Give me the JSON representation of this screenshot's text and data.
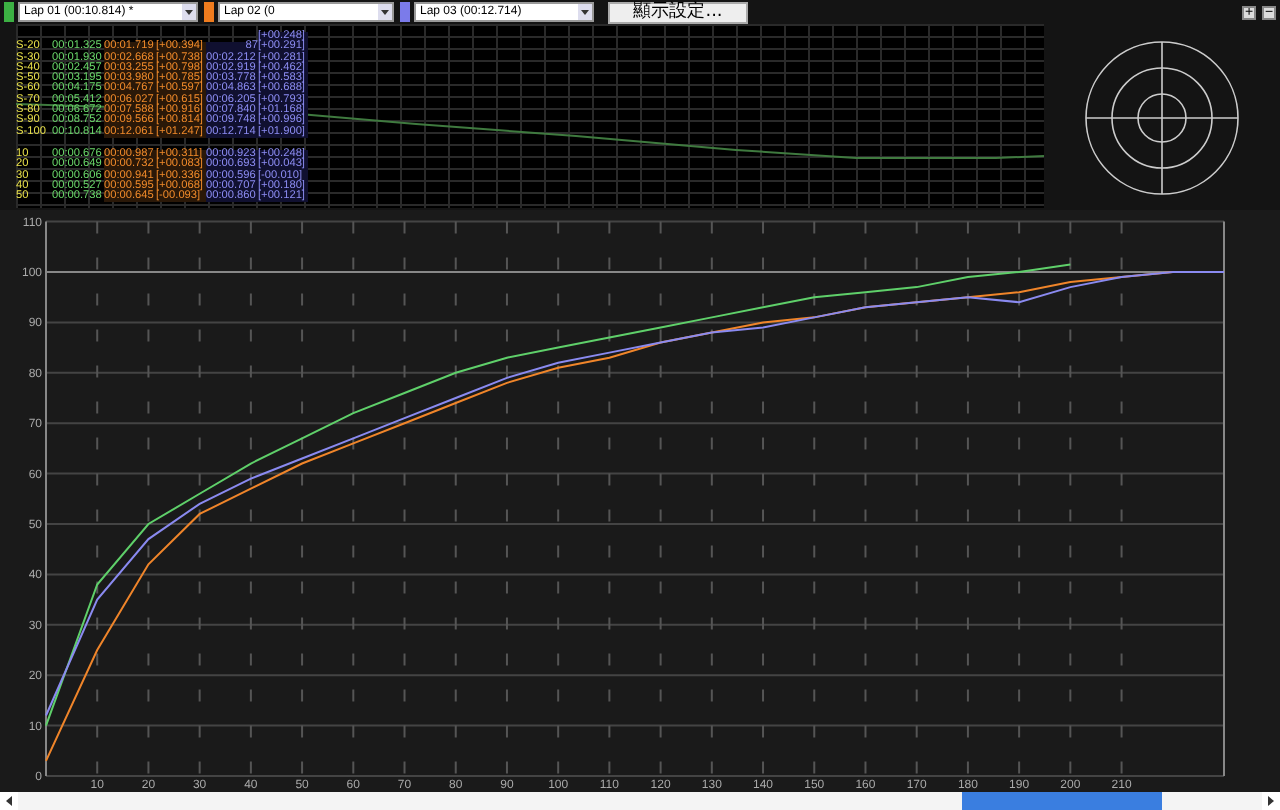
{
  "toolbar": {
    "laps": [
      {
        "label": "Lap 01 (00:10.814) *",
        "color": "#3cb043"
      },
      {
        "label": "Lap 02 (0",
        "color": "#f07c1e"
      },
      {
        "label": "Lap 03 (00:12.714)",
        "color": "#7b7bea"
      }
    ],
    "button": "顯示設定...",
    "zoom_buttons": [
      "+",
      "−"
    ]
  },
  "speed_splits": [
    {
      "d3": "[+00.248]"
    },
    {
      "label": "S-20",
      "t1": "00:01.325",
      "t2": "00:01.719",
      "d2": "[+00.394]",
      "t3": "87",
      "d3": "[+00.291]"
    },
    {
      "label": "S-30",
      "t1": "00:01.930",
      "t2": "00:02.668",
      "d2": "[+00.738]",
      "t3": "00:02.212",
      "d3": "[+00.281]"
    },
    {
      "label": "S-40",
      "t1": "00:02.457",
      "t2": "00:03.255",
      "d2": "[+00.798]",
      "t3": "00:02.919",
      "d3": "[+00.462]"
    },
    {
      "label": "S-50",
      "t1": "00:03.195",
      "t2": "00:03.980",
      "d2": "[+00.785]",
      "t3": "00:03.778",
      "d3": "[+00.583]"
    },
    {
      "label": "S-60",
      "t1": "00:04.175",
      "t2": "00:04.767",
      "d2": "[+00.597]",
      "t3": "00:04.863",
      "d3": "[+00.688]"
    },
    {
      "label": "S-70",
      "t1": "00:05.412",
      "t2": "00:06.027",
      "d2": "[+00.615]",
      "t3": "00:06.205",
      "d3": "[+00.793]"
    },
    {
      "label": "S-80",
      "t1": "00:06.672",
      "t2": "00:07.588",
      "d2": "[+00.916]",
      "t3": "00:07.840",
      "d3": "[+01.168]"
    },
    {
      "label": "S-90",
      "t1": "00:08.752",
      "t2": "00:09.566",
      "d2": "[+00.814]",
      "t3": "00:09.748",
      "d3": "[+00.996]"
    },
    {
      "label": "S-100",
      "t1": "00:10.814",
      "t2": "00:12.061",
      "d2": "[+01.247]",
      "t3": "00:12.714",
      "d3": "[+01.900]"
    }
  ],
  "distance_splits": [
    {
      "label": "10",
      "t1": "00:00.676",
      "t2": "00:00.987",
      "d2": "[+00.311]",
      "t3": "00:00.923",
      "d3": "[+00.248]"
    },
    {
      "label": "20",
      "t1": "00:00.649",
      "t2": "00:00.732",
      "d2": "[+00.083]",
      "t3": "00:00.693",
      "d3": "[+00.043]"
    },
    {
      "label": "30",
      "t1": "00:00.606",
      "t2": "00:00.941",
      "d2": "[+00.336]",
      "t3": "00:00.596",
      "d3": "[-00.010]"
    },
    {
      "label": "40",
      "t1": "00:00.527",
      "t2": "00:00.595",
      "d2": "[+00.068]",
      "t3": "00:00.707",
      "d3": "[+00.180]"
    },
    {
      "label": "50",
      "t1": "00:00.738",
      "t2": "00:00.645",
      "d2": "[-00.093]",
      "t3": "00:00.860",
      "d3": "[+00.121]"
    }
  ],
  "main_chart": {
    "chart_data": {
      "type": "line",
      "x": [
        0,
        10,
        20,
        30,
        40,
        50,
        60,
        70,
        80,
        90,
        100,
        110,
        120,
        130,
        140,
        150,
        160,
        170,
        180,
        190,
        200,
        210,
        220,
        230
      ],
      "xlim": [
        0,
        230
      ],
      "ylim": [
        0,
        110
      ],
      "grid": true,
      "ref_lines": [
        {
          "axis": "y",
          "value": 100
        }
      ],
      "series": [
        {
          "color": "#5fd06a",
          "values": [
            10,
            38,
            50,
            56,
            62,
            67,
            72,
            76,
            80,
            83,
            85,
            87,
            89,
            91,
            93,
            95,
            96,
            97,
            99,
            100,
            101.5,
            null,
            null,
            null
          ]
        },
        {
          "color": "#f0852a",
          "values": [
            3,
            25,
            42,
            52,
            57,
            62,
            66,
            70,
            74,
            78,
            81,
            83,
            86,
            88,
            90,
            91,
            93,
            94,
            95,
            96,
            98,
            99,
            100,
            null
          ]
        },
        {
          "color": "#8a8af0",
          "values": [
            12,
            35,
            47,
            54,
            59,
            63,
            67,
            71,
            75,
            79,
            82,
            84,
            86,
            88,
            89,
            91,
            93,
            94,
            95,
            94,
            97,
            99,
            100,
            100
          ]
        }
      ],
      "xticks": [
        10,
        20,
        30,
        40,
        50,
        60,
        70,
        80,
        90,
        100,
        110,
        120,
        130,
        140,
        150,
        160,
        170,
        180,
        190,
        200,
        210
      ],
      "yticks": [
        0,
        10,
        20,
        30,
        40,
        50,
        60,
        70,
        80,
        90,
        100,
        110
      ]
    }
  }
}
